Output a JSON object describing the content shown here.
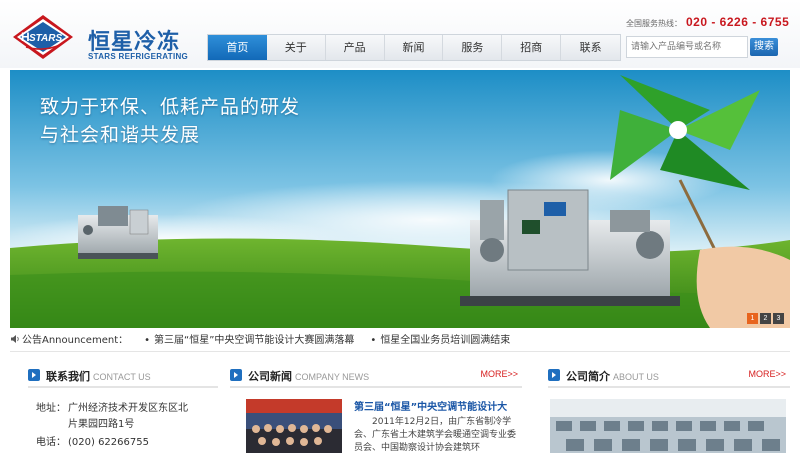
{
  "brand": {
    "logo_text": "STARS",
    "logo_letter": "H",
    "name_cn": "恒星冷冻",
    "name_en": "STARS REFRIGERATING"
  },
  "hotline": {
    "label": "全国服务热线：",
    "number": "020 - 6226 - 6755"
  },
  "nav": {
    "items": [
      "首页",
      "关于",
      "产品",
      "新闻",
      "服务",
      "招商",
      "联系"
    ],
    "active_index": 0
  },
  "search": {
    "placeholder": "请输入产品编号或名称",
    "button_label": "搜索"
  },
  "banner": {
    "slogan_line1": "致力于环保、低耗产品的研发",
    "slogan_line2": "与社会和谐共发展",
    "slides": [
      "1",
      "2",
      "3"
    ],
    "active_slide": 0
  },
  "announcement": {
    "label": "公告Announcement：",
    "items": [
      "第三届“恒星”中央空调节能设计大赛圆满落幕",
      "恒星全国业务员培训圆满结束"
    ]
  },
  "contact": {
    "title_cn": "联系我们",
    "title_en": "CONTACT US",
    "address_label": "地址：",
    "address_line1": "广州经济技术开发区东区北",
    "address_line2": "片果园四路1号",
    "phone_label": "电话：",
    "phone_value": "(020) 62266755"
  },
  "news": {
    "title_cn": "公司新闻",
    "title_en": "COMPANY NEWS",
    "more": "MORE>>",
    "headline": "第三届“恒星”中央空调节能设计大",
    "body": "2011年12月2日，由广东省制冷学会、广东省土木建筑学会暖通空调专业委员会、中国勘察设计协会建筑环"
  },
  "about": {
    "title_cn": "公司简介",
    "title_en": "ABOUT US",
    "more": "MORE>>"
  },
  "colors": {
    "brand_blue": "#1e5fa8",
    "nav_active": "#1f7bc8",
    "hotline_red": "#c8171e",
    "more_red": "#d61f1f",
    "slide_active": "#e8641d"
  }
}
